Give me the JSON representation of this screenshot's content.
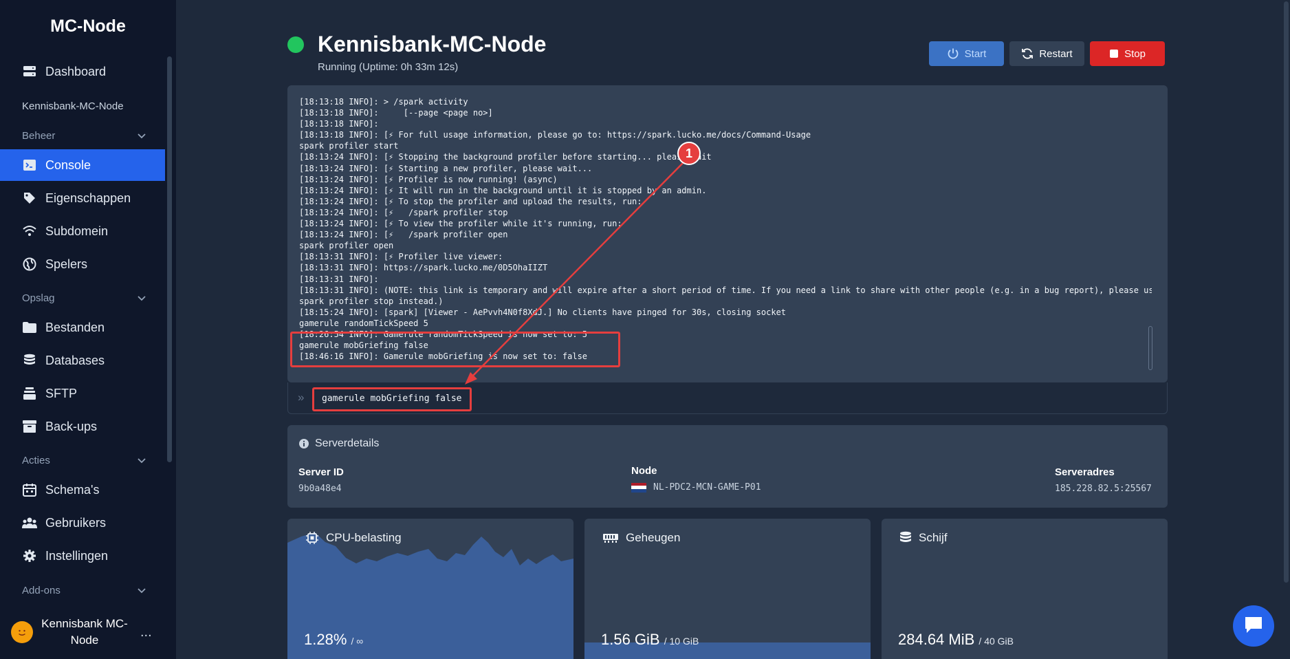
{
  "sidebar": {
    "brand": "MC-Node",
    "dashboard": "Dashboard",
    "server_name": "Kennisbank-MC-Node",
    "groups": {
      "beheer": "Beheer",
      "opslag": "Opslag",
      "acties": "Acties",
      "addons": "Add-ons"
    },
    "items": {
      "console": "Console",
      "eigenschappen": "Eigenschappen",
      "subdomein": "Subdomein",
      "spelers": "Spelers",
      "bestanden": "Bestanden",
      "databases": "Databases",
      "sftp": "SFTP",
      "backups": "Back-ups",
      "schemas": "Schema's",
      "gebruikers": "Gebruikers",
      "instellingen": "Instellingen"
    },
    "user": {
      "name_line1": "Kennisbank MC-",
      "name_line2": "Node",
      "more": "..."
    }
  },
  "header": {
    "title": "Kennisbank-MC-Node",
    "status": "Running (Uptime: 0h 33m 12s)",
    "status_color": "#22c55e",
    "start_label": "Start",
    "restart_label": "Restart",
    "stop_label": "Stop"
  },
  "console": {
    "lines": [
      "[18:13:18 INFO]: > /spark activity",
      "[18:13:18 INFO]:     [--page <page no>]",
      "[18:13:18 INFO]:",
      "[18:13:18 INFO]: [⚡ For full usage information, please go to: https://spark.lucko.me/docs/Command-Usage",
      "spark profiler start",
      "[18:13:24 INFO]: [⚡ Stopping the background profiler before starting... please wait",
      "[18:13:24 INFO]: [⚡ Starting a new profiler, please wait...",
      "[18:13:24 INFO]: [⚡ Profiler is now running! (async)",
      "[18:13:24 INFO]: [⚡ It will run in the background until it is stopped by an admin.",
      "[18:13:24 INFO]: [⚡ To stop the profiler and upload the results, run:",
      "[18:13:24 INFO]: [⚡   /spark profiler stop",
      "[18:13:24 INFO]: [⚡ To view the profiler while it's running, run:",
      "[18:13:24 INFO]: [⚡   /spark profiler open",
      "spark profiler open",
      "[18:13:31 INFO]: [⚡ Profiler live viewer:",
      "[18:13:31 INFO]: https://spark.lucko.me/0D5OhaIIZT",
      "[18:13:31 INFO]:",
      "[18:13:31 INFO]: (NOTE: this link is temporary and will expire after a short period of time. If you need a link to share with other people (e.g. in a bug report), please use /",
      "spark profiler stop instead.)",
      "[18:15:24 INFO]: [spark] [Viewer - AePvvh4N0f8XdJ.] No clients have pinged for 30s, closing socket",
      "gamerule randomTickSpeed 5",
      "[18:26:54 INFO]: Gamerule randomTickSpeed is now set to: 5",
      "gamerule mobGriefing false",
      "[18:46:16 INFO]: Gamerule mobGriefing is now set to: false"
    ],
    "input_value": "gamerule mobGriefing false",
    "prompt_symbol": "»"
  },
  "annotation": {
    "badge": "1",
    "color": "#e53e3e"
  },
  "details": {
    "title": "Serverdetails",
    "server_id_label": "Server ID",
    "server_id": "9b0a48e4",
    "node_label": "Node",
    "node": "NL-PDC2-MCN-GAME-P01",
    "address_label": "Serveradres",
    "address": "185.228.82.5:25567"
  },
  "stats": {
    "cpu": {
      "title": "CPU-belasting",
      "value": "1.28%",
      "limit": "/ ∞"
    },
    "memory": {
      "title": "Geheugen",
      "value": "1.56 GiB",
      "limit": "/ 10 GiB",
      "fraction": 0.156
    },
    "disk": {
      "title": "Schijf",
      "value": "284.64 MiB",
      "limit": "/ 40 GiB",
      "fraction": 0.007
    }
  }
}
